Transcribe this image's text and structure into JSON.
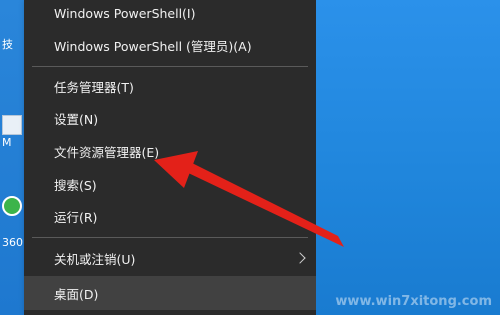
{
  "desktop": {
    "left_labels": [
      "技",
      "M",
      "360"
    ],
    "watermark": "www.win7xitong.com"
  },
  "menu": {
    "items": [
      {
        "label": "Windows PowerShell(I)"
      },
      {
        "label": "Windows PowerShell (管理员)(A)"
      },
      {
        "label": "任务管理器(T)"
      },
      {
        "label": "设置(N)"
      },
      {
        "label": "文件资源管理器(E)"
      },
      {
        "label": "搜索(S)"
      },
      {
        "label": "运行(R)"
      },
      {
        "label": "关机或注销(U)"
      },
      {
        "label": "桌面(D)"
      }
    ]
  },
  "colors": {
    "menu_bg": "#2b2b2b",
    "menu_hover": "#414141",
    "arrow": "#e32119",
    "desktop": "#1f7fd6"
  }
}
